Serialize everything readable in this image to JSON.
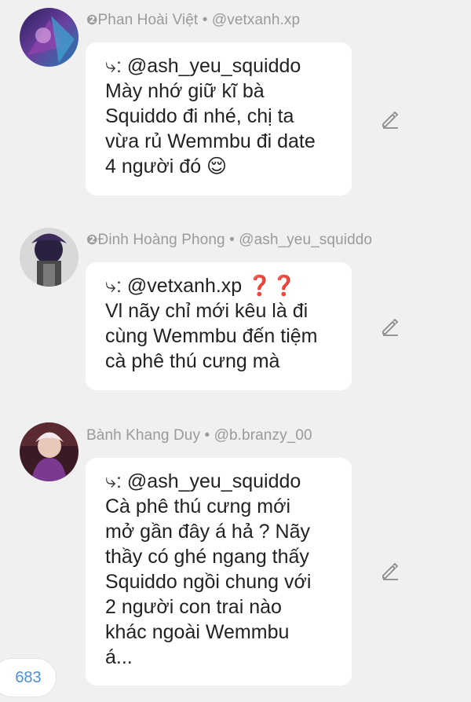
{
  "messages": [
    {
      "author_number": "❷",
      "author_name": "Phan Hoài Việt",
      "separator": "•",
      "handle": "@vetxanh.xp",
      "reply_prefix": "⤷:",
      "reply_to": "@ash_yeu_squiddo",
      "reply_emoji": "",
      "lines": [
        "Mày nhớ giữ kĩ bà",
        "Squiddo đi nhé, chị ta",
        "vừa rủ Wemmbu đi date",
        "4 người đó 😌"
      ],
      "avatar_icon": "avatar-user-icon",
      "edit_icon": "pencil-icon"
    },
    {
      "author_number": "❷",
      "author_name": "Đinh Hoàng Phong",
      "separator": "•",
      "handle": "@ash_yeu_squiddo",
      "reply_prefix": "⤷:",
      "reply_to": "@vetxanh.xp",
      "reply_emoji": "❓❓",
      "lines": [
        "Vl nãy chỉ mới kêu là đi",
        "cùng Wemmbu đến tiệm",
        "cà phê thú cưng mà"
      ],
      "avatar_icon": "avatar-user-icon",
      "edit_icon": "pencil-icon"
    },
    {
      "author_number": "",
      "author_name": "Bành Khang Duy",
      "separator": "•",
      "handle": "@b.branzy_00",
      "reply_prefix": "⤷:",
      "reply_to": "@ash_yeu_squiddo",
      "reply_emoji": "",
      "lines": [
        "Cà phê thú cưng mới",
        "mở gần đây á hả ? Nãy",
        "thầy có ghé ngang thấy",
        "Squiddo ngồi chung với",
        "2 người con trai nào",
        "khác ngoài Wemmbu",
        "á..."
      ],
      "avatar_icon": "avatar-user-icon",
      "edit_icon": "pencil-icon"
    }
  ],
  "counter": "683",
  "colors": {
    "background": "#f0f0f0",
    "bubble": "#ffffff",
    "meta_text": "#9a9a9a",
    "body_text": "#222222",
    "counter_text": "#4a90d9",
    "emoji_red": "#e53935"
  }
}
